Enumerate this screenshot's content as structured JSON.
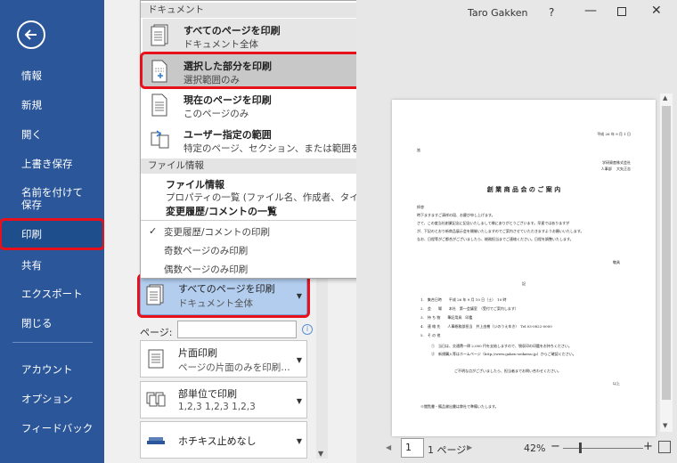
{
  "sidebar": {
    "items": [
      "情報",
      "新規",
      "開く",
      "上書き保存",
      "名前を付けて保存",
      "印刷",
      "共有",
      "エクスポート",
      "閉じる",
      "アカウント",
      "オプション",
      "フィードバック"
    ]
  },
  "dropdown": {
    "section_document": "ドキュメント",
    "print_all": {
      "title": "すべてのページを印刷",
      "sub": "ドキュメント全体"
    },
    "print_selection": {
      "title": "選択した部分を印刷",
      "sub": "選択範囲のみ"
    },
    "print_current": {
      "title": "現在のページを印刷",
      "sub": "このページのみ"
    },
    "print_custom": {
      "title": "ユーザー指定の範囲",
      "sub": "特定のページ、セクション、または範囲を入力します"
    },
    "section_fileinfo": "ファイル情報",
    "file_info": {
      "title": "ファイル情報",
      "sub": "プロパティの一覧 (ファイル名、作成者、タイトルなど)"
    },
    "change_history": {
      "title": "変更履歴/コメントの一覧"
    },
    "check_item": "変更履歴/コメントの印刷",
    "odd_pages": "奇数ページのみ印刷",
    "even_pages": "偶数ページのみ印刷"
  },
  "panel": {
    "selected_option": {
      "title": "すべてのページを印刷",
      "sub": "ドキュメント全体"
    },
    "page_label": "ページ:",
    "one_side": {
      "title": "片面印刷",
      "sub": "ページの片面のみを印刷…"
    },
    "collate": {
      "title": "部単位で印刷",
      "sub": "1,2,3    1,2,3    1,2,3"
    },
    "staple": {
      "title": "ホチキス止めなし"
    }
  },
  "titlebar": {
    "user": "Taro Gakken",
    "help": "?"
  },
  "preview": {
    "date": "平成 26 年 9 月 1 日",
    "to": "皆",
    "sender1": "学研資産株式会社",
    "sender2": "人事部 　大矢正志",
    "doc_title": "創 業 商 品 会 の ご 案 内",
    "greet": "拝啓",
    "body1": "時下ますますご清祥の段、お慶び申し上げます。",
    "body2": "さて、この度当社創業記念に記念いたしまして様にありがとうございます。早速ではありますが",
    "body3": "が、下記のとおり新商品展示会を開催いたしますのでご案内させていただきますようお願いいたします。",
    "body4": "なお、日程等がご都合がございましたら、総務担当までご連絡ください。日程を調整いたします。",
    "closing": "敬具",
    "ki": "記",
    "l1": "1.　集合日時　　平成 26 年 9 月 10 日（土）　10 時",
    "l2": "2.　会　　場　　本社　第一会議室　（受付でご案内します）",
    "l3": "3.　持 ち 物　　筆記用具　印鑑",
    "l4": "4.　連 絡 先　　人事総務部担当　井上由樹（いのうえゆき）　Tel.03-0822-0000",
    "l5": "5.　そ の 他",
    "n1": "①　当日は、交通費一律 2,000 円を支給しますので、領収印の印鑑をお持ちください。",
    "n2": "②　新規購入等はホームページ（http://www.gaken-seikatsu.jp）からご確認ください。",
    "ending": "ご不明な点がございましたら、担当者までお問い合わせください。",
    "end": "以上",
    "footnote": "※閲覧書・備品貸出書は弊社で準備いたします。"
  },
  "bottom": {
    "page": "1",
    "total": "1 ページ",
    "zoom": "42%"
  },
  "colors": {
    "sidebar": "#2b579a",
    "highlight": "#e8101a",
    "selected": "#b2cdee"
  }
}
